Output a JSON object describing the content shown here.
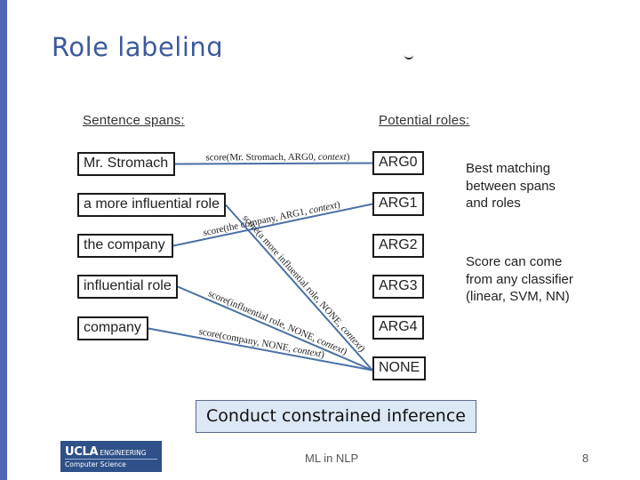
{
  "slide": {
    "title": "Role labeling",
    "page_number": "8",
    "footer_text": "ML in NLP",
    "accent_color": "#4f67b1",
    "title_color": "#3c5a9c"
  },
  "diagram": {
    "spans_header": "Sentence spans:",
    "roles_header": "Potential roles:",
    "spans": [
      {
        "label": "Mr. Stromach"
      },
      {
        "label": "a more influential role"
      },
      {
        "label": "the company"
      },
      {
        "label": "influential role"
      },
      {
        "label": "company"
      }
    ],
    "roles": [
      {
        "label": "ARG0"
      },
      {
        "label": "ARG1"
      },
      {
        "label": "ARG2"
      },
      {
        "label": "ARG3"
      },
      {
        "label": "ARG4"
      },
      {
        "label": "NONE"
      }
    ],
    "edges": [
      {
        "from": "Mr. Stromach",
        "to": "ARG0",
        "label": "score(Mr. Stromach, ARG0, context)"
      },
      {
        "from": "the company",
        "to": "ARG1",
        "label": "score(the company, ARG1, context)"
      },
      {
        "from": "a more influential role",
        "to": "NONE",
        "label": "score(a more influential role, NONE, context)"
      },
      {
        "from": "influential role",
        "to": "NONE",
        "label": "score(influential role, NONE, context)"
      },
      {
        "from": "company",
        "to": "NONE",
        "label": "score(company, NONE, context)"
      }
    ],
    "edge_color": "#4a6fa5",
    "notes": [
      [
        "Best matching",
        "between spans",
        "and roles"
      ],
      [
        "Score can come",
        "from any classifier",
        "(linear, SVM, NN)"
      ]
    ]
  },
  "callout": {
    "text": "Conduct constrained inference"
  },
  "logo": {
    "line1_bold": "UCLA",
    "line1_rest": "ENGINEERING",
    "line2": "Computer Science"
  }
}
